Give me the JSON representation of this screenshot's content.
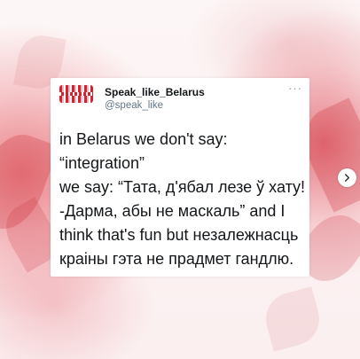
{
  "tweet": {
    "display_name": "Speak_like_Belarus",
    "handle": "@speak_like",
    "more_icon": "···",
    "text": "in Belarus we don't say:\n“integration”\nwe say: “Тата, д'ябал лезе ў хату!\n-Дарма, абы не маскаль” and I\nthink that's fun but незалежнасць\nкраіны гэта не прадмет гандлю."
  },
  "navigation": {
    "next_icon": "chevron-right-icon"
  },
  "colors": {
    "accent_red": "#d62331",
    "text_primary": "#14171a",
    "text_secondary": "#657786"
  }
}
